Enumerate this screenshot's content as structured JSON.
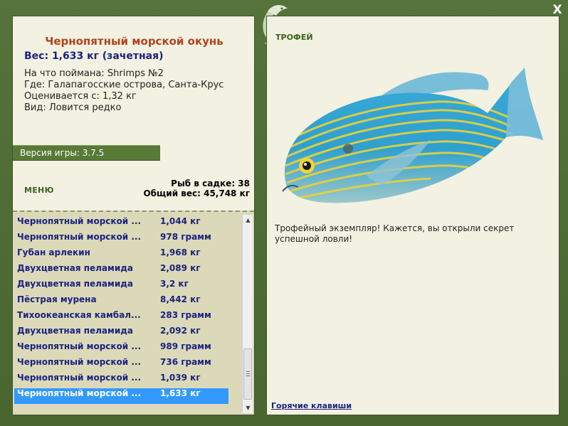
{
  "window": {
    "close_label": "X"
  },
  "fish": {
    "title": "Чернопятный морской окунь",
    "weight_line": "Вес: 1,633 кг (зачетная)",
    "caught_with": "На что поймана: Shrimps №2",
    "location": "Где: Галапагосские острова, Санта-Крус",
    "value": "Оценивается с: 1,32 кг",
    "rarity": "Вид: Ловится редко"
  },
  "version": "Версия игры: 3.7.5",
  "menu_label": "МЕНЮ",
  "keepnet": {
    "count_line": "Рыб в садке: 38",
    "total_line": "Общий вес: 45,748 кг"
  },
  "catch_list": [
    {
      "name": "Чернопятный морской ...",
      "weight": "1,044 кг"
    },
    {
      "name": "Чернопятный морской ...",
      "weight": "978 грамм"
    },
    {
      "name": "Губан арлекин",
      "weight": "1,968 кг"
    },
    {
      "name": "Двухцветная пеламида",
      "weight": "2,089 кг"
    },
    {
      "name": "Двухцветная пеламида",
      "weight": "3,2 кг"
    },
    {
      "name": "Пёстрая мурена",
      "weight": "8,442 кг"
    },
    {
      "name": "Тихоокеанская камбал...",
      "weight": "283 грамм"
    },
    {
      "name": "Двухцветная пеламида",
      "weight": "2,092 кг"
    },
    {
      "name": "Чернопятный морской ...",
      "weight": "989 грамм"
    },
    {
      "name": "Чернопятный морской ...",
      "weight": "736 грамм"
    },
    {
      "name": "Чернопятный морской ...",
      "weight": "1,039 кг"
    },
    {
      "name": "Чернопятный морской ...",
      "weight": "1,633 кг"
    }
  ],
  "selected_index": 11,
  "trophy": {
    "label": "ТРОФЕЙ",
    "message": "Трофейный экземпляр! Кажется, вы открыли секрет успешной ловли!"
  },
  "hotkeys_label": "Горячие клавиши",
  "colors": {
    "frame": "#4f6a33",
    "panel": "#f3f1e2",
    "list_bg": "#dcd9b9",
    "title": "#b0431f",
    "accent_text": "#1a237e",
    "selection": "#3399ff",
    "fish_body": "#2fa6d9",
    "fish_stripes": "#e8d23a"
  },
  "icons": {
    "emblem": "leaping-fish-icon",
    "close": "close-icon",
    "scroll_up": "chevron-up-icon",
    "scroll_down": "chevron-down-icon"
  }
}
